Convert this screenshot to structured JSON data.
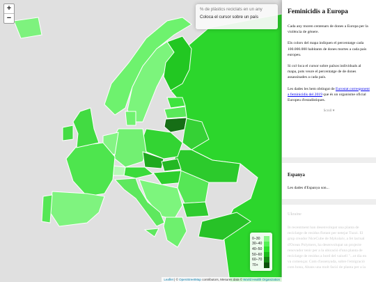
{
  "map": {
    "zoom_in": "+",
    "zoom_out": "−",
    "info": {
      "title": "% de plàstics reciclats en un any",
      "subtitle": "Coloca el cursor sobre un país"
    },
    "legend": [
      {
        "label": "0–30",
        "color": "#88f888"
      },
      {
        "label": "30–40",
        "color": "#55f055"
      },
      {
        "label": "40–50",
        "color": "#2ce02c"
      },
      {
        "label": "50–60",
        "color": "#1bbb1b"
      },
      {
        "label": "60–70",
        "color": "#138613"
      },
      {
        "label": "70+",
        "color": "#0a520a"
      }
    ],
    "attribution": {
      "leaflet": "Leaflet",
      "sep": " | © ",
      "osm": "OpenStreetMap",
      "mid": " contributors, Mesures data © ",
      "who": "World Health Organization"
    }
  },
  "panel": {
    "title": "Feminicidis a Europa",
    "p1": "Cada any moren centenars de dones a Europa per la violència de gènere.",
    "p2": "Els colors del mapa indiquen el percentatge cada 100.000.000 habitants de dones mortes a cada país europeu.",
    "p3": "Si col·loca el cursor sobre països individuals al mapa, pots veure el percentatge de de dones assassinades a cada país.",
    "p4_pre": "Les dades les hem obtingut de ",
    "p4_link": "Eurostat corresponent a feminicidis del 2019",
    "p4_post": " que és un organisme oficial Europeu d'estadístiques.",
    "scroll": "Scroll ▾",
    "spain_title": "Espanya",
    "spain_text": "Les dades d'Espanya son...",
    "ukraine_title": "Ukraine",
    "ukraine_text": "In recentment han desenvolupat una planta de reciclatge de residus flotant per netejar Tuzzi. El grup creador NiceCube de Mykolaiv, a fet lactual d'Ocean Polymers, ha desenvolupat un projecte renovador tenir per a la ubicació d'una planta de reciclatge de residus a bord del vaixell \"...ot dia en va començar. Com d'assenyada, sobre l'emigració com bona, Abans una molt fació de planta per a la"
  }
}
